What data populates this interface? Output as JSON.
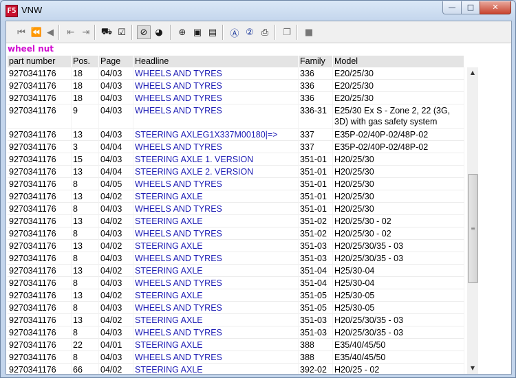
{
  "window": {
    "title": "VNW",
    "app_icon": "F5",
    "minimize": "—",
    "maximize": "□",
    "close": "✕"
  },
  "toolbar": {
    "buttons": [
      {
        "name": "first-page-icon",
        "glyph": "⏮",
        "style": "grey"
      },
      {
        "name": "double-back-icon",
        "glyph": "⏪",
        "style": "grey"
      },
      {
        "name": "back-icon",
        "glyph": "◀",
        "style": "grey"
      },
      {
        "name": "prev-document-icon",
        "glyph": "⇤",
        "style": "grey"
      },
      {
        "name": "next-document-icon",
        "glyph": "⇥",
        "style": "grey"
      },
      {
        "name": "cart-icon",
        "glyph": "⛟",
        "style": "dark"
      },
      {
        "name": "checklist-icon",
        "glyph": "☑",
        "style": "dark"
      },
      {
        "name": "no-parts-filter-icon",
        "glyph": "⊘",
        "style": "dark"
      },
      {
        "name": "globe-icon",
        "glyph": "◕",
        "style": "dark"
      },
      {
        "name": "zoom-icon",
        "glyph": "⊕",
        "style": "dark"
      },
      {
        "name": "page-icon",
        "glyph": "▣",
        "style": "dark"
      },
      {
        "name": "page-alt-icon",
        "glyph": "▤",
        "style": "dark"
      },
      {
        "name": "search-a-icon",
        "glyph": "Ⓐ",
        "style": "blue"
      },
      {
        "name": "search-2-icon",
        "glyph": "②",
        "style": "blue"
      },
      {
        "name": "printer-icon",
        "glyph": "⎙",
        "style": "dark"
      },
      {
        "name": "copy-icon",
        "glyph": "❐",
        "style": "grey"
      },
      {
        "name": "stop-icon",
        "glyph": "■",
        "style": "grey"
      }
    ]
  },
  "search_term": "wheel nut",
  "table": {
    "columns": [
      "part number",
      "Pos.",
      "Page",
      "Headline",
      "Family",
      "Model"
    ],
    "rows": [
      [
        "9270341176",
        "18",
        "04/03",
        "WHEELS AND TYRES",
        "336",
        "E20/25/30"
      ],
      [
        "9270341176",
        "18",
        "04/03",
        "WHEELS AND TYRES",
        "336",
        "E20/25/30"
      ],
      [
        "9270341176",
        "18",
        "04/03",
        "WHEELS AND TYRES",
        "336",
        "E20/25/30"
      ],
      [
        "9270341176",
        "9",
        "04/03",
        "WHEELS AND TYRES",
        "336-31",
        "E25/30 Ex S - Zone 2, 22 (3G, 3D) with gas safety system"
      ],
      [
        "9270341176",
        "13",
        "04/03",
        "STEERING AXLEG1X337M00180|=>",
        "337",
        "E35P-02/40P-02/48P-02"
      ],
      [
        "9270341176",
        "3",
        "04/04",
        "WHEELS AND TYRES",
        "337",
        "E35P-02/40P-02/48P-02"
      ],
      [
        "9270341176",
        "15",
        "04/03",
        "STEERING AXLE 1. VERSION",
        "351-01",
        "H20/25/30"
      ],
      [
        "9270341176",
        "13",
        "04/04",
        "STEERING AXLE 2. VERSION",
        "351-01",
        "H20/25/30"
      ],
      [
        "9270341176",
        "8",
        "04/05",
        "WHEELS AND TYRES",
        "351-01",
        "H20/25/30"
      ],
      [
        "9270341176",
        "13",
        "04/02",
        "STEERING AXLE",
        "351-01",
        "H20/25/30"
      ],
      [
        "9270341176",
        "8",
        "04/03",
        "WHEELS AND TYRES",
        "351-01",
        "H20/25/30"
      ],
      [
        "9270341176",
        "13",
        "04/02",
        "STEERING AXLE",
        "351-02",
        "H20/25/30 - 02"
      ],
      [
        "9270341176",
        "8",
        "04/03",
        "WHEELS AND TYRES",
        "351-02",
        "H20/25/30 - 02"
      ],
      [
        "9270341176",
        "13",
        "04/02",
        "STEERING AXLE",
        "351-03",
        "H20/25/30/35 - 03"
      ],
      [
        "9270341176",
        "8",
        "04/03",
        "WHEELS AND TYRES",
        "351-03",
        "H20/25/30/35 - 03"
      ],
      [
        "9270341176",
        "13",
        "04/02",
        "STEERING AXLE",
        "351-04",
        "H25/30-04"
      ],
      [
        "9270341176",
        "8",
        "04/03",
        "WHEELS AND TYRES",
        "351-04",
        "H25/30-04"
      ],
      [
        "9270341176",
        "13",
        "04/02",
        "STEERING AXLE",
        "351-05",
        "H25/30-05"
      ],
      [
        "9270341176",
        "8",
        "04/03",
        "WHEELS AND TYRES",
        "351-05",
        "H25/30-05"
      ],
      [
        "9270341176",
        "13",
        "04/02",
        "STEERING AXLE",
        "351-03",
        "H20/25/30/35 - 03"
      ],
      [
        "9270341176",
        "8",
        "04/03",
        "WHEELS AND TYRES",
        "351-03",
        "H20/25/30/35 - 03"
      ],
      [
        "9270341176",
        "22",
        "04/01",
        "STEERING AXLE",
        "388",
        "E35/40/45/50"
      ],
      [
        "9270341176",
        "8",
        "04/03",
        "WHEELS AND TYRES",
        "388",
        "E35/40/45/50"
      ],
      [
        "9270341176",
        "66",
        "04/02",
        "STEERING AXLE",
        "392-02",
        "H20/25 - 02"
      ]
    ]
  },
  "scrollbar": {
    "up": "▲",
    "down": "▼",
    "grip": "≡"
  }
}
